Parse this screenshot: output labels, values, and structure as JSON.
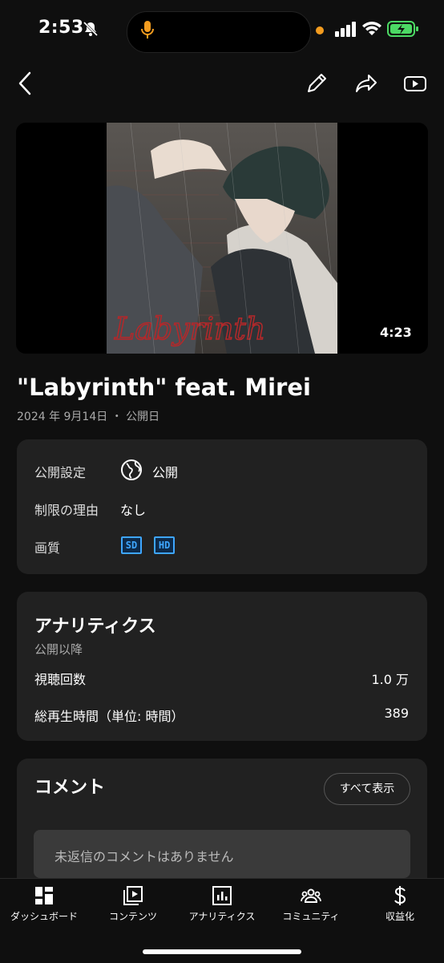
{
  "status": {
    "time": "2:53"
  },
  "video": {
    "duration": "4:23",
    "title": "\"Labyrinth\" feat. Mirei",
    "date": "2024 年 9月14日 ・ 公開日",
    "thumbnail_text": "Labyrinth"
  },
  "details": {
    "visibility_label": "公開設定",
    "visibility_value": "公開",
    "restriction_label": "制限の理由",
    "restriction_value": "なし",
    "quality_label": "画質",
    "quality_badges": [
      "SD",
      "HD"
    ]
  },
  "analytics": {
    "title": "アナリティクス",
    "subtitle": "公開以降",
    "views_label": "視聴回数",
    "views_value": "1.0 万",
    "watchtime_label": "総再生時間（単位: 時間）",
    "watchtime_value": "389"
  },
  "comments": {
    "title": "コメント",
    "show_all": "すべて表示",
    "empty": "未返信のコメントはありません"
  },
  "nav": [
    {
      "label": "ダッシュボード",
      "icon": "dashboard-icon"
    },
    {
      "label": "コンテンツ",
      "icon": "content-icon"
    },
    {
      "label": "アナリティクス",
      "icon": "analytics-icon"
    },
    {
      "label": "コミュニティ",
      "icon": "community-icon"
    },
    {
      "label": "収益化",
      "icon": "monetization-icon"
    }
  ],
  "colors": {
    "accent_blue": "#3ea6ff",
    "background": "#0f0f0f",
    "card": "#212121",
    "battery": "#4cd964",
    "mic": "#f39c1f"
  }
}
